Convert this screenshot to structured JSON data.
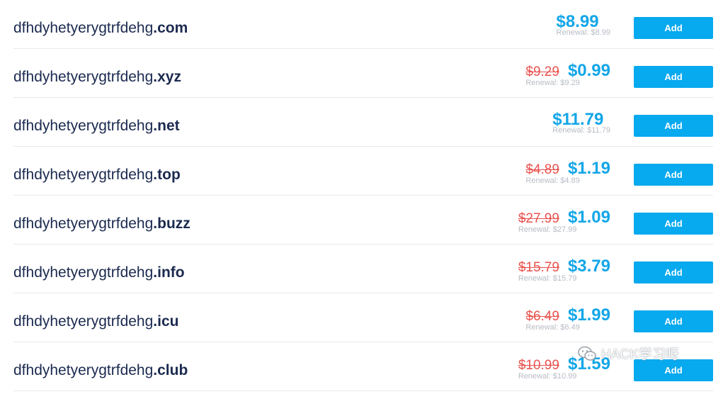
{
  "domains": [
    {
      "base": "dfhdyhetyerygtrfdehg",
      "tld": ".com",
      "old_price": "",
      "price": "$8.99",
      "renewal": "Renewal: $8.99",
      "button": "Add"
    },
    {
      "base": "dfhdyhetyerygtrfdehg",
      "tld": ".xyz",
      "old_price": "$9.29",
      "price": "$0.99",
      "renewal": "Renewal: $9.29",
      "button": "Add"
    },
    {
      "base": "dfhdyhetyerygtrfdehg",
      "tld": ".net",
      "old_price": "",
      "price": "$11.79",
      "renewal": "Renewal: $11.79",
      "button": "Add"
    },
    {
      "base": "dfhdyhetyerygtrfdehg",
      "tld": ".top",
      "old_price": "$4.89",
      "price": "$1.19",
      "renewal": "Renewal: $4.89",
      "button": "Add"
    },
    {
      "base": "dfhdyhetyerygtrfdehg",
      "tld": ".buzz",
      "old_price": "$27.99",
      "price": "$1.09",
      "renewal": "Renewal: $27.99",
      "button": "Add"
    },
    {
      "base": "dfhdyhetyerygtrfdehg",
      "tld": ".info",
      "old_price": "$15.79",
      "price": "$3.79",
      "renewal": "Renewal: $15.79",
      "button": "Add"
    },
    {
      "base": "dfhdyhetyerygtrfdehg",
      "tld": ".icu",
      "old_price": "$6.49",
      "price": "$1.99",
      "renewal": "Renewal: $6.49",
      "button": "Add"
    },
    {
      "base": "dfhdyhetyerygtrfdehg",
      "tld": ".club",
      "old_price": "$10.99",
      "price": "$1.59",
      "renewal": "Renewal: $10.99",
      "button": "Add"
    }
  ],
  "watermark": {
    "icon": "wechat-icon",
    "text": "HACK学习呀"
  },
  "colors": {
    "domain_text": "#1b2a4f",
    "price": "#13a6e8",
    "old_price": "#e8534f",
    "renewal": "#b7bcc4",
    "button": "#07a9ef"
  }
}
